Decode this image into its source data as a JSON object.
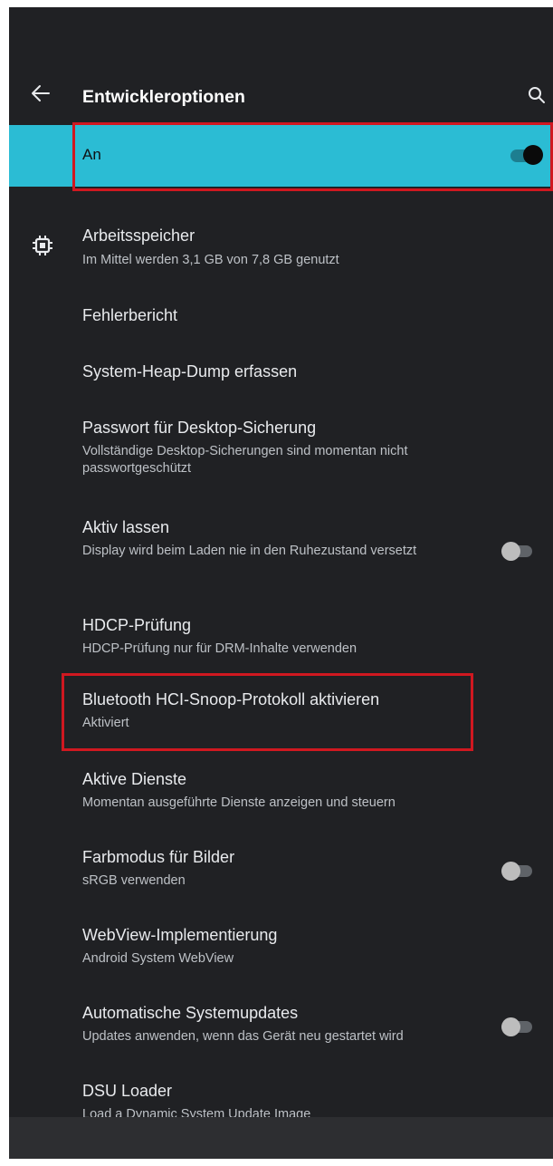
{
  "appbar": {
    "title": "Entwickleroptionen",
    "back_icon": "arrow-left-icon",
    "search_icon": "search-icon"
  },
  "master": {
    "label": "An",
    "switch_on": true
  },
  "items": [
    {
      "title": "Arbeitsspeicher",
      "subtitle": "Im Mittel werden 3,1 GB von 7,8 GB genutzt",
      "icon": "memory-chip-icon"
    },
    {
      "title": "Fehlerbericht",
      "subtitle": ""
    },
    {
      "title": "System-Heap-Dump erfassen",
      "subtitle": ""
    },
    {
      "title": "Passwort für Desktop-Sicherung",
      "subtitle": "Vollständige Desktop-Sicherungen sind momentan nicht passwortgeschützt"
    },
    {
      "title": "Aktiv lassen",
      "subtitle": "Display wird beim Laden nie in den Ruhezustand versetzt",
      "switch_on": false
    },
    {
      "title": "HDCP-Prüfung",
      "subtitle": "HDCP-Prüfung nur für DRM-Inhalte verwenden"
    },
    {
      "title": "Bluetooth HCI-Snoop-Protokoll aktivieren",
      "subtitle": "Aktiviert"
    },
    {
      "title": "Aktive Dienste",
      "subtitle": "Momentan ausgeführte Dienste anzeigen und steuern"
    },
    {
      "title": "Farbmodus für Bilder",
      "subtitle": "sRGB verwenden",
      "switch_on": false
    },
    {
      "title": "WebView-Implementierung",
      "subtitle": "Android System WebView"
    },
    {
      "title": "Automatische Systemupdates",
      "subtitle": "Updates anwenden, wenn das Gerät neu gestartet wird",
      "switch_on": false
    },
    {
      "title": "DSU Loader",
      "subtitle": "Load a Dynamic System Update Image"
    }
  ],
  "colors": {
    "background": "#202124",
    "accent": "#2bbcd4",
    "highlight": "#d01820"
  }
}
